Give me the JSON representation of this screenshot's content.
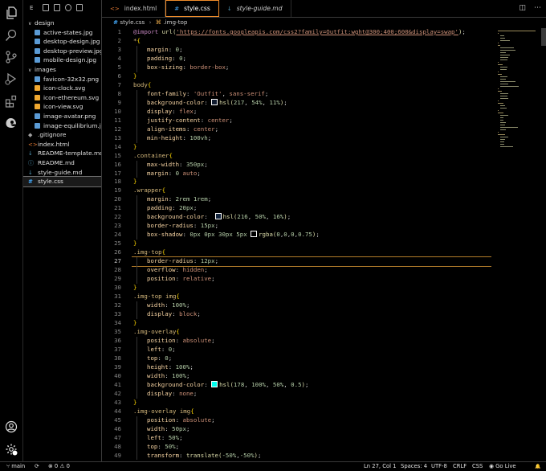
{
  "explorer": {
    "header": "E",
    "items": [
      {
        "label": "design",
        "kind": "folder",
        "depth": 0
      },
      {
        "label": "active-states.jpg",
        "kind": "img",
        "depth": 1
      },
      {
        "label": "desktop-design.jpg",
        "kind": "img",
        "depth": 1
      },
      {
        "label": "desktop-preview.jpg",
        "kind": "img",
        "depth": 1
      },
      {
        "label": "mobile-design.jpg",
        "kind": "img",
        "depth": 1
      },
      {
        "label": "images",
        "kind": "folder",
        "depth": 0
      },
      {
        "label": "favicon-32x32.png",
        "kind": "img",
        "depth": 1
      },
      {
        "label": "icon-clock.svg",
        "kind": "svg",
        "depth": 1
      },
      {
        "label": "icon-ethereum.svg",
        "kind": "svg",
        "depth": 1
      },
      {
        "label": "icon-view.svg",
        "kind": "svg",
        "depth": 1
      },
      {
        "label": "image-avatar.png",
        "kind": "img",
        "depth": 1
      },
      {
        "label": "image-equilibrium.jpg",
        "kind": "img",
        "depth": 1
      },
      {
        "label": ".gitignore",
        "kind": "git",
        "depth": 0
      },
      {
        "label": "index.html",
        "kind": "html",
        "depth": 0
      },
      {
        "label": "README-template.md",
        "kind": "md",
        "depth": 0
      },
      {
        "label": "README.md",
        "kind": "info",
        "depth": 0
      },
      {
        "label": "style-guide.md",
        "kind": "md",
        "depth": 0
      },
      {
        "label": "style.css",
        "kind": "css",
        "depth": 0,
        "active": true
      }
    ]
  },
  "tabs": [
    {
      "label": "index.html",
      "icon": "html-icon",
      "glyph": "<>"
    },
    {
      "label": "style.css",
      "icon": "css-icon",
      "glyph": "#",
      "active": true
    },
    {
      "label": "style-guide.md",
      "icon": "markdown-icon",
      "glyph": "↓"
    }
  ],
  "tab_actions": {
    "split": "◫",
    "more": "⋯"
  },
  "breadcrumb": {
    "file": "style.css",
    "file_glyph": "#",
    "symbol": ".img-top",
    "symbol_glyph": "⌘"
  },
  "code_lines": [
    [
      [
        "kw",
        "@import "
      ],
      [
        "fn",
        "url("
      ],
      [
        "url",
        "'https://fonts.googleapis.com/css2?family=Outfit:wght@300;400;600&display=swap'"
      ],
      [
        "fn",
        ")"
      ],
      [
        "punc",
        ";"
      ]
    ],
    [
      [
        "sel",
        "*"
      ],
      [
        "brace",
        "{"
      ]
    ],
    [
      [
        "i",
        ""
      ],
      [
        "prop",
        "margin"
      ],
      [
        "punc",
        ": "
      ],
      [
        "num",
        "0"
      ],
      [
        "punc",
        ";"
      ]
    ],
    [
      [
        "i",
        ""
      ],
      [
        "prop",
        "padding"
      ],
      [
        "punc",
        ": "
      ],
      [
        "num",
        "0"
      ],
      [
        "punc",
        ";"
      ]
    ],
    [
      [
        "i",
        ""
      ],
      [
        "prop",
        "box-sizing"
      ],
      [
        "punc",
        ": "
      ],
      [
        "val",
        "border-box"
      ],
      [
        "punc",
        ";"
      ]
    ],
    [
      [
        "brace",
        "}"
      ]
    ],
    [
      [
        "sel",
        "body"
      ],
      [
        "brace",
        "{"
      ]
    ],
    [
      [
        "i",
        ""
      ],
      [
        "prop",
        "font-family"
      ],
      [
        "punc",
        ": "
      ],
      [
        "val",
        "'Outfit'"
      ],
      [
        "punc",
        ", "
      ],
      [
        "val",
        "sans-serif"
      ],
      [
        "punc",
        ";"
      ]
    ],
    [
      [
        "i",
        ""
      ],
      [
        "prop",
        "background-color"
      ],
      [
        "punc",
        ": "
      ],
      [
        "sw",
        "#111c30"
      ],
      [
        "fn",
        "hsl("
      ],
      [
        "num",
        "217"
      ],
      [
        "punc",
        ", "
      ],
      [
        "num",
        "54%"
      ],
      [
        "punc",
        ", "
      ],
      [
        "num",
        "11%"
      ],
      [
        "fn",
        ")"
      ],
      [
        "punc",
        ";"
      ]
    ],
    [
      [
        "i",
        ""
      ],
      [
        "prop",
        "display"
      ],
      [
        "punc",
        ": "
      ],
      [
        "val",
        "flex"
      ],
      [
        "punc",
        ";"
      ]
    ],
    [
      [
        "i",
        ""
      ],
      [
        "prop",
        "justify-content"
      ],
      [
        "punc",
        ": "
      ],
      [
        "val",
        "center"
      ],
      [
        "punc",
        ";"
      ]
    ],
    [
      [
        "i",
        ""
      ],
      [
        "prop",
        "align-items"
      ],
      [
        "punc",
        ": "
      ],
      [
        "val",
        "center"
      ],
      [
        "punc",
        ";"
      ]
    ],
    [
      [
        "i",
        ""
      ],
      [
        "prop",
        "min-height"
      ],
      [
        "punc",
        ": "
      ],
      [
        "num",
        "100vh"
      ],
      [
        "punc",
        ";"
      ]
    ],
    [
      [
        "brace",
        "}"
      ]
    ],
    [
      [
        "sel",
        ".container"
      ],
      [
        "brace",
        "{"
      ]
    ],
    [
      [
        "i",
        ""
      ],
      [
        "prop",
        "max-width"
      ],
      [
        "punc",
        ": "
      ],
      [
        "num",
        "350px"
      ],
      [
        "punc",
        ";"
      ]
    ],
    [
      [
        "i",
        ""
      ],
      [
        "prop",
        "margin"
      ],
      [
        "punc",
        ": "
      ],
      [
        "num",
        "0"
      ],
      [
        "punc",
        " "
      ],
      [
        "val",
        "auto"
      ],
      [
        "punc",
        ";"
      ]
    ],
    [
      [
        "brace",
        "}"
      ]
    ],
    [
      [
        "sel",
        ".wrapper"
      ],
      [
        "brace",
        "{"
      ]
    ],
    [
      [
        "i",
        ""
      ],
      [
        "prop",
        "margin"
      ],
      [
        "punc",
        ": "
      ],
      [
        "num",
        "2rem"
      ],
      [
        "punc",
        " "
      ],
      [
        "num",
        "1rem"
      ],
      [
        "punc",
        ";"
      ]
    ],
    [
      [
        "i",
        ""
      ],
      [
        "prop",
        "padding"
      ],
      [
        "punc",
        ": "
      ],
      [
        "num",
        "20px"
      ],
      [
        "punc",
        ";"
      ]
    ],
    [
      [
        "i",
        ""
      ],
      [
        "prop",
        "background-color"
      ],
      [
        "punc",
        ":  "
      ],
      [
        "sw",
        "#15263f"
      ],
      [
        "fn",
        "hsl("
      ],
      [
        "num",
        "216"
      ],
      [
        "punc",
        ", "
      ],
      [
        "num",
        "50%"
      ],
      [
        "punc",
        ", "
      ],
      [
        "num",
        "16%"
      ],
      [
        "fn",
        ")"
      ],
      [
        "punc",
        ";"
      ]
    ],
    [
      [
        "i",
        ""
      ],
      [
        "prop",
        "border-radius"
      ],
      [
        "punc",
        ": "
      ],
      [
        "num",
        "15px"
      ],
      [
        "punc",
        ";"
      ]
    ],
    [
      [
        "i",
        ""
      ],
      [
        "prop",
        "box-shadow"
      ],
      [
        "punc",
        ": "
      ],
      [
        "num",
        "0px"
      ],
      [
        "punc",
        " "
      ],
      [
        "num",
        "0px"
      ],
      [
        "punc",
        " "
      ],
      [
        "num",
        "30px"
      ],
      [
        "punc",
        " "
      ],
      [
        "num",
        "5px"
      ],
      [
        "punc",
        " "
      ],
      [
        "sw",
        "#000000"
      ],
      [
        "fn",
        "rgba("
      ],
      [
        "num",
        "0"
      ],
      [
        "punc",
        ","
      ],
      [
        "num",
        "0"
      ],
      [
        "punc",
        ","
      ],
      [
        "num",
        "0"
      ],
      [
        "punc",
        ","
      ],
      [
        "num",
        "0.75"
      ],
      [
        "fn",
        ")"
      ],
      [
        "punc",
        ";"
      ]
    ],
    [
      [
        "brace",
        "}"
      ]
    ],
    [
      [
        "sel",
        ".img-top"
      ],
      [
        "brace",
        "{"
      ]
    ],
    [
      [
        "i",
        ""
      ],
      [
        "prop",
        "border-radius"
      ],
      [
        "punc",
        ": "
      ],
      [
        "num",
        "12px"
      ],
      [
        "punc",
        ";"
      ]
    ],
    [
      [
        "i",
        ""
      ],
      [
        "prop",
        "overflow"
      ],
      [
        "punc",
        ": "
      ],
      [
        "val",
        "hidden"
      ],
      [
        "punc",
        ";"
      ]
    ],
    [
      [
        "i",
        ""
      ],
      [
        "prop",
        "position"
      ],
      [
        "punc",
        ": "
      ],
      [
        "val",
        "relative"
      ],
      [
        "punc",
        ";"
      ]
    ],
    [
      [
        "brace",
        "}"
      ]
    ],
    [
      [
        "sel",
        ".img-top img"
      ],
      [
        "brace",
        "{"
      ]
    ],
    [
      [
        "i",
        ""
      ],
      [
        "prop",
        "width"
      ],
      [
        "punc",
        ": "
      ],
      [
        "num",
        "100%"
      ],
      [
        "punc",
        ";"
      ]
    ],
    [
      [
        "i",
        ""
      ],
      [
        "prop",
        "display"
      ],
      [
        "punc",
        ": "
      ],
      [
        "val",
        "block"
      ],
      [
        "punc",
        ";"
      ]
    ],
    [
      [
        "brace",
        "}"
      ]
    ],
    [
      [
        "sel",
        ".img-overlay"
      ],
      [
        "brace",
        "{"
      ]
    ],
    [
      [
        "i",
        ""
      ],
      [
        "prop",
        "position"
      ],
      [
        "punc",
        ": "
      ],
      [
        "val",
        "absolute"
      ],
      [
        "punc",
        ";"
      ]
    ],
    [
      [
        "i",
        ""
      ],
      [
        "prop",
        "left"
      ],
      [
        "punc",
        ": "
      ],
      [
        "num",
        "0"
      ],
      [
        "punc",
        ";"
      ]
    ],
    [
      [
        "i",
        ""
      ],
      [
        "prop",
        "top"
      ],
      [
        "punc",
        ": "
      ],
      [
        "num",
        "0"
      ],
      [
        "punc",
        ";"
      ]
    ],
    [
      [
        "i",
        ""
      ],
      [
        "prop",
        "height"
      ],
      [
        "punc",
        ": "
      ],
      [
        "num",
        "100%"
      ],
      [
        "punc",
        ";"
      ]
    ],
    [
      [
        "i",
        ""
      ],
      [
        "prop",
        "width"
      ],
      [
        "punc",
        ": "
      ],
      [
        "num",
        "100%"
      ],
      [
        "punc",
        ";"
      ]
    ],
    [
      [
        "i",
        ""
      ],
      [
        "prop",
        "background-color"
      ],
      [
        "punc",
        ": "
      ],
      [
        "sw",
        "#00ffef"
      ],
      [
        "fn",
        "hsl("
      ],
      [
        "num",
        "178"
      ],
      [
        "punc",
        ", "
      ],
      [
        "num",
        "100%"
      ],
      [
        "punc",
        ", "
      ],
      [
        "num",
        "50%"
      ],
      [
        "punc",
        ", "
      ],
      [
        "num",
        "0.5"
      ],
      [
        "fn",
        ")"
      ],
      [
        "punc",
        ";"
      ]
    ],
    [
      [
        "i",
        ""
      ],
      [
        "prop",
        "display"
      ],
      [
        "punc",
        ": "
      ],
      [
        "val",
        "none"
      ],
      [
        "punc",
        ";"
      ]
    ],
    [
      [
        "brace",
        "}"
      ]
    ],
    [
      [
        "sel",
        ".img-overlay img"
      ],
      [
        "brace",
        "{"
      ]
    ],
    [
      [
        "i",
        ""
      ],
      [
        "prop",
        "position"
      ],
      [
        "punc",
        ": "
      ],
      [
        "val",
        "absolute"
      ],
      [
        "punc",
        ";"
      ]
    ],
    [
      [
        "i",
        ""
      ],
      [
        "prop",
        "width"
      ],
      [
        "punc",
        ": "
      ],
      [
        "num",
        "50px"
      ],
      [
        "punc",
        ";"
      ]
    ],
    [
      [
        "i",
        ""
      ],
      [
        "prop",
        "left"
      ],
      [
        "punc",
        ": "
      ],
      [
        "num",
        "50%"
      ],
      [
        "punc",
        ";"
      ]
    ],
    [
      [
        "i",
        ""
      ],
      [
        "prop",
        "top"
      ],
      [
        "punc",
        ": "
      ],
      [
        "num",
        "50%"
      ],
      [
        "punc",
        ";"
      ]
    ],
    [
      [
        "i",
        ""
      ],
      [
        "prop",
        "transform"
      ],
      [
        "punc",
        ": "
      ],
      [
        "fn",
        "translate("
      ],
      [
        "num",
        "-50%"
      ],
      [
        "punc",
        ","
      ],
      [
        "num",
        "-50%"
      ],
      [
        "fn",
        ")"
      ],
      [
        "punc",
        ";"
      ]
    ]
  ],
  "current_line": 27,
  "status": {
    "branch": "main",
    "sync_glyph": "⟳",
    "errors": "0",
    "warnings": "0",
    "error_glyph": "⊗",
    "warning_glyph": "⚠",
    "position": "Ln 27, Col 1",
    "spaces": "Spaces: 4",
    "encoding": "UTF-8",
    "eol": "CRLF",
    "language": "CSS",
    "golive": "Go Live",
    "bell_glyph": "🔔"
  },
  "colors": {
    "accent": "#f08c2a"
  }
}
